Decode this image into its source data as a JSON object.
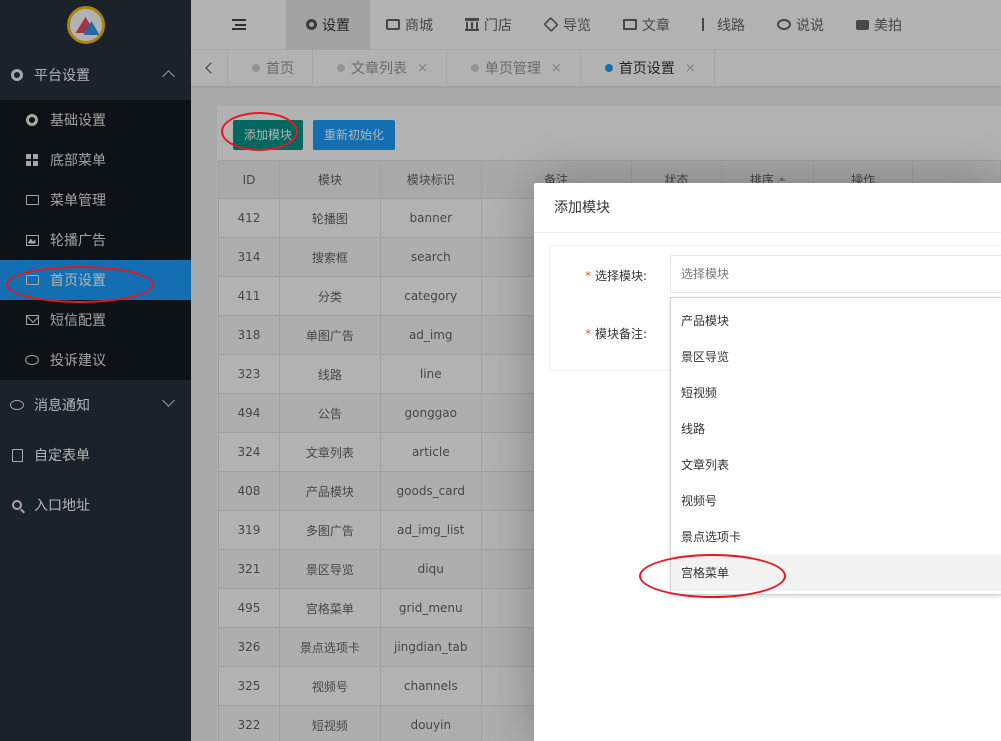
{
  "sidebar": {
    "logo": "logo",
    "groups": [
      {
        "label": "平台设置",
        "icon": "gear-icon",
        "expanded": true
      },
      {
        "label": "消息通知",
        "icon": "chat-bubble-icon",
        "expanded": false
      },
      {
        "label": "自定表单",
        "icon": "form-icon"
      },
      {
        "label": "入口地址",
        "icon": "search-icon"
      }
    ],
    "items": [
      {
        "label": "基础设置",
        "icon": "gear-icon"
      },
      {
        "label": "底部菜单",
        "icon": "grid-icon"
      },
      {
        "label": "菜单管理",
        "icon": "monitor-icon"
      },
      {
        "label": "轮播广告",
        "icon": "image-icon"
      },
      {
        "label": "首页设置",
        "icon": "monitor-icon",
        "active": true
      },
      {
        "label": "短信配置",
        "icon": "mail-icon"
      },
      {
        "label": "投诉建议",
        "icon": "chat-icon"
      }
    ]
  },
  "topnav": {
    "items": [
      {
        "label": "设置",
        "icon": "gear-icon",
        "active": true
      },
      {
        "label": "商城",
        "icon": "bag-icon"
      },
      {
        "label": "门店",
        "icon": "bank-icon"
      },
      {
        "label": "导览",
        "icon": "cubes-icon"
      },
      {
        "label": "文章",
        "icon": "newspaper-icon"
      },
      {
        "label": "线路",
        "icon": "route-icon"
      },
      {
        "label": "说说",
        "icon": "wechat-icon"
      },
      {
        "label": "美拍",
        "icon": "video-icon"
      }
    ]
  },
  "tabs": [
    {
      "label": "首页",
      "closable": false
    },
    {
      "label": "文章列表",
      "closable": true
    },
    {
      "label": "单页管理",
      "closable": true
    },
    {
      "label": "首页设置",
      "closable": true,
      "active": true
    }
  ],
  "tab_close_glyph": "×",
  "toolbar": {
    "add_label": "添加模块",
    "reinit_label": "重新初始化"
  },
  "table": {
    "headers": [
      "ID",
      "模块",
      "模块标识",
      "备注",
      "状态",
      "排序",
      "操作"
    ],
    "rows": [
      [
        "412",
        "轮播图",
        "banner"
      ],
      [
        "314",
        "搜索框",
        "search"
      ],
      [
        "411",
        "分类",
        "category"
      ],
      [
        "318",
        "单图广告",
        "ad_img"
      ],
      [
        "323",
        "线路",
        "line"
      ],
      [
        "494",
        "公告",
        "gonggao"
      ],
      [
        "324",
        "文章列表",
        "article"
      ],
      [
        "408",
        "产品模块",
        "goods_card"
      ],
      [
        "319",
        "多图广告",
        "ad_img_list"
      ],
      [
        "321",
        "景区导览",
        "diqu"
      ],
      [
        "495",
        "宫格菜单",
        "grid_menu"
      ],
      [
        "326",
        "景点选项卡",
        "jingdian_tab"
      ],
      [
        "325",
        "视频号",
        "channels"
      ],
      [
        "322",
        "短视频",
        "douyin"
      ]
    ]
  },
  "modal": {
    "title": "添加模块",
    "required_mark": "*",
    "select_label": "选择模块:",
    "select_placeholder": "选择模块",
    "remark_label": "模块备注:",
    "options": [
      "产品模块",
      "景区导览",
      "短视频",
      "线路",
      "文章列表",
      "视频号",
      "景点选项卡",
      "宫格菜单"
    ],
    "hovered_option": "宫格菜单"
  },
  "colors": {
    "sidebar_bg": "#28313c",
    "sidebar_sub_bg": "#131a22",
    "active_blue": "#1e9fff",
    "add_button_green": "#009688",
    "highlight_red": "#e8171f",
    "required_red": "#ff5722"
  }
}
